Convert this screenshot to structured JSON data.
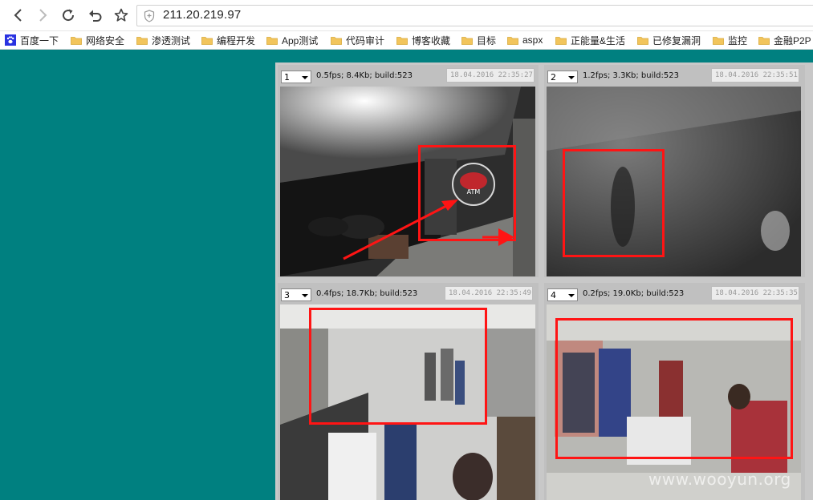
{
  "browser": {
    "url": "211.20.219.97",
    "nav": [
      "back-icon",
      "forward-icon",
      "reload-icon",
      "undo-icon",
      "star-icon"
    ]
  },
  "bookmarks": [
    {
      "label": "百度一下",
      "icon": "paw-icon"
    },
    {
      "label": "网络安全",
      "icon": "folder-icon"
    },
    {
      "label": "渗透测试",
      "icon": "folder-icon"
    },
    {
      "label": "编程开发",
      "icon": "folder-icon"
    },
    {
      "label": "App测试",
      "icon": "folder-icon"
    },
    {
      "label": "代码审计",
      "icon": "folder-icon"
    },
    {
      "label": "博客收藏",
      "icon": "folder-icon"
    },
    {
      "label": "目标",
      "icon": "folder-icon"
    },
    {
      "label": "aspx",
      "icon": "folder-icon"
    },
    {
      "label": "正能量&生活",
      "icon": "folder-icon"
    },
    {
      "label": "已修复漏洞",
      "icon": "folder-icon"
    },
    {
      "label": "监控",
      "icon": "folder-icon"
    },
    {
      "label": "金融P2P",
      "icon": "folder-icon"
    }
  ],
  "cameras": [
    {
      "id": "1",
      "stats": "0.5fps; 8.4Kb; build:523",
      "timestamp": "18.04.2016 22:35:27"
    },
    {
      "id": "2",
      "stats": "1.2fps; 3.3Kb; build:523",
      "timestamp": "18.04.2016 22:35:51"
    },
    {
      "id": "3",
      "stats": "0.4fps; 18.7Kb; build:523",
      "timestamp": "18.04.2016 22:35:49"
    },
    {
      "id": "4",
      "stats": "0.2fps; 19.0Kb; build:523",
      "timestamp": "18.04.2016 22:35:35"
    }
  ],
  "atm_sign": "ATM",
  "watermark": "www.wooyun.org",
  "colors": {
    "page_bg": "#008080",
    "highlight": "#ff1414",
    "panel": "#c0c0c0"
  }
}
